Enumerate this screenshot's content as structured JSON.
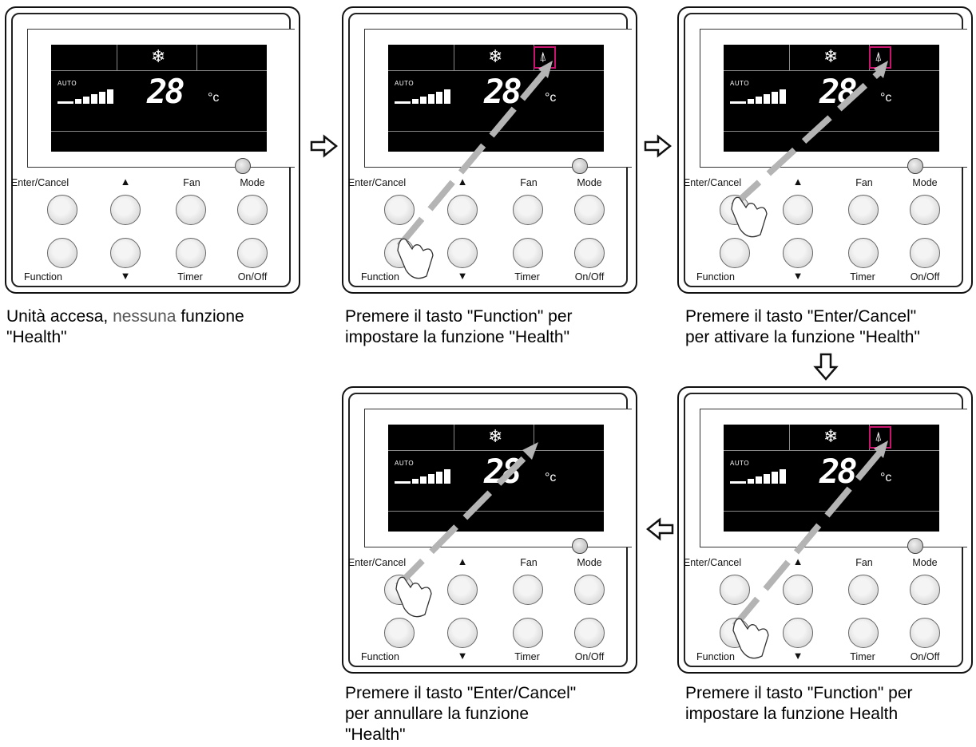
{
  "panels": [
    {
      "id": "p1",
      "health": false,
      "press": null,
      "caption_parts": [
        "Unità accesa, ",
        "nessuna",
        " funzione",
        "\"Health\""
      ]
    },
    {
      "id": "p2",
      "health": true,
      "press": "function",
      "caption_parts": [
        "Premere il tasto \"Function\" per",
        "impostare la funzione \"Health\""
      ]
    },
    {
      "id": "p3",
      "health": true,
      "press": "enter",
      "caption_parts": [
        "Premere il tasto \"Enter/Cancel\"",
        "per attivare la funzione \"Health\""
      ]
    },
    {
      "id": "p4",
      "health": false,
      "press": "enter",
      "caption_parts": [
        "Premere il tasto \"Enter/Cancel\"",
        "per annullare la funzione",
        "\"Health\""
      ]
    },
    {
      "id": "p5",
      "health": true,
      "press": "function",
      "caption_parts": [
        "Premere il tasto \"Function\" per",
        "impostare la funzione Health"
      ]
    }
  ],
  "display": {
    "auto_label": "AUTO",
    "temperature": "28",
    "unit": "°c",
    "mode_icon": "snowflake-icon",
    "health_icon": "tree-icon"
  },
  "buttons": {
    "enter_cancel": "Enter/Cancel",
    "up": "▲",
    "fan": "Fan",
    "mode": "Mode",
    "function": "Function",
    "down": "▼",
    "timer": "Timer",
    "onoff": "On/Off"
  },
  "colors": {
    "highlight": "#c8146e",
    "lcd": "#000000",
    "press_path": "#b4b4b4"
  },
  "flow": [
    "right",
    "right",
    "down",
    "left"
  ]
}
